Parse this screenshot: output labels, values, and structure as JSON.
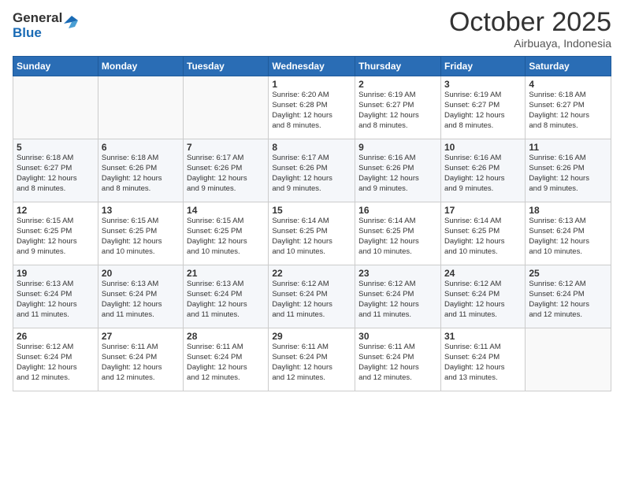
{
  "header": {
    "logo_general": "General",
    "logo_blue": "Blue",
    "month": "October 2025",
    "location": "Airbuaya, Indonesia"
  },
  "weekdays": [
    "Sunday",
    "Monday",
    "Tuesday",
    "Wednesday",
    "Thursday",
    "Friday",
    "Saturday"
  ],
  "weeks": [
    [
      {
        "day": "",
        "info": ""
      },
      {
        "day": "",
        "info": ""
      },
      {
        "day": "",
        "info": ""
      },
      {
        "day": "1",
        "info": "Sunrise: 6:20 AM\nSunset: 6:28 PM\nDaylight: 12 hours\nand 8 minutes."
      },
      {
        "day": "2",
        "info": "Sunrise: 6:19 AM\nSunset: 6:27 PM\nDaylight: 12 hours\nand 8 minutes."
      },
      {
        "day": "3",
        "info": "Sunrise: 6:19 AM\nSunset: 6:27 PM\nDaylight: 12 hours\nand 8 minutes."
      },
      {
        "day": "4",
        "info": "Sunrise: 6:18 AM\nSunset: 6:27 PM\nDaylight: 12 hours\nand 8 minutes."
      }
    ],
    [
      {
        "day": "5",
        "info": "Sunrise: 6:18 AM\nSunset: 6:27 PM\nDaylight: 12 hours\nand 8 minutes."
      },
      {
        "day": "6",
        "info": "Sunrise: 6:18 AM\nSunset: 6:26 PM\nDaylight: 12 hours\nand 8 minutes."
      },
      {
        "day": "7",
        "info": "Sunrise: 6:17 AM\nSunset: 6:26 PM\nDaylight: 12 hours\nand 9 minutes."
      },
      {
        "day": "8",
        "info": "Sunrise: 6:17 AM\nSunset: 6:26 PM\nDaylight: 12 hours\nand 9 minutes."
      },
      {
        "day": "9",
        "info": "Sunrise: 6:16 AM\nSunset: 6:26 PM\nDaylight: 12 hours\nand 9 minutes."
      },
      {
        "day": "10",
        "info": "Sunrise: 6:16 AM\nSunset: 6:26 PM\nDaylight: 12 hours\nand 9 minutes."
      },
      {
        "day": "11",
        "info": "Sunrise: 6:16 AM\nSunset: 6:26 PM\nDaylight: 12 hours\nand 9 minutes."
      }
    ],
    [
      {
        "day": "12",
        "info": "Sunrise: 6:15 AM\nSunset: 6:25 PM\nDaylight: 12 hours\nand 9 minutes."
      },
      {
        "day": "13",
        "info": "Sunrise: 6:15 AM\nSunset: 6:25 PM\nDaylight: 12 hours\nand 10 minutes."
      },
      {
        "day": "14",
        "info": "Sunrise: 6:15 AM\nSunset: 6:25 PM\nDaylight: 12 hours\nand 10 minutes."
      },
      {
        "day": "15",
        "info": "Sunrise: 6:14 AM\nSunset: 6:25 PM\nDaylight: 12 hours\nand 10 minutes."
      },
      {
        "day": "16",
        "info": "Sunrise: 6:14 AM\nSunset: 6:25 PM\nDaylight: 12 hours\nand 10 minutes."
      },
      {
        "day": "17",
        "info": "Sunrise: 6:14 AM\nSunset: 6:25 PM\nDaylight: 12 hours\nand 10 minutes."
      },
      {
        "day": "18",
        "info": "Sunrise: 6:13 AM\nSunset: 6:24 PM\nDaylight: 12 hours\nand 10 minutes."
      }
    ],
    [
      {
        "day": "19",
        "info": "Sunrise: 6:13 AM\nSunset: 6:24 PM\nDaylight: 12 hours\nand 11 minutes."
      },
      {
        "day": "20",
        "info": "Sunrise: 6:13 AM\nSunset: 6:24 PM\nDaylight: 12 hours\nand 11 minutes."
      },
      {
        "day": "21",
        "info": "Sunrise: 6:13 AM\nSunset: 6:24 PM\nDaylight: 12 hours\nand 11 minutes."
      },
      {
        "day": "22",
        "info": "Sunrise: 6:12 AM\nSunset: 6:24 PM\nDaylight: 12 hours\nand 11 minutes."
      },
      {
        "day": "23",
        "info": "Sunrise: 6:12 AM\nSunset: 6:24 PM\nDaylight: 12 hours\nand 11 minutes."
      },
      {
        "day": "24",
        "info": "Sunrise: 6:12 AM\nSunset: 6:24 PM\nDaylight: 12 hours\nand 11 minutes."
      },
      {
        "day": "25",
        "info": "Sunrise: 6:12 AM\nSunset: 6:24 PM\nDaylight: 12 hours\nand 12 minutes."
      }
    ],
    [
      {
        "day": "26",
        "info": "Sunrise: 6:12 AM\nSunset: 6:24 PM\nDaylight: 12 hours\nand 12 minutes."
      },
      {
        "day": "27",
        "info": "Sunrise: 6:11 AM\nSunset: 6:24 PM\nDaylight: 12 hours\nand 12 minutes."
      },
      {
        "day": "28",
        "info": "Sunrise: 6:11 AM\nSunset: 6:24 PM\nDaylight: 12 hours\nand 12 minutes."
      },
      {
        "day": "29",
        "info": "Sunrise: 6:11 AM\nSunset: 6:24 PM\nDaylight: 12 hours\nand 12 minutes."
      },
      {
        "day": "30",
        "info": "Sunrise: 6:11 AM\nSunset: 6:24 PM\nDaylight: 12 hours\nand 12 minutes."
      },
      {
        "day": "31",
        "info": "Sunrise: 6:11 AM\nSunset: 6:24 PM\nDaylight: 12 hours\nand 13 minutes."
      },
      {
        "day": "",
        "info": ""
      }
    ]
  ]
}
